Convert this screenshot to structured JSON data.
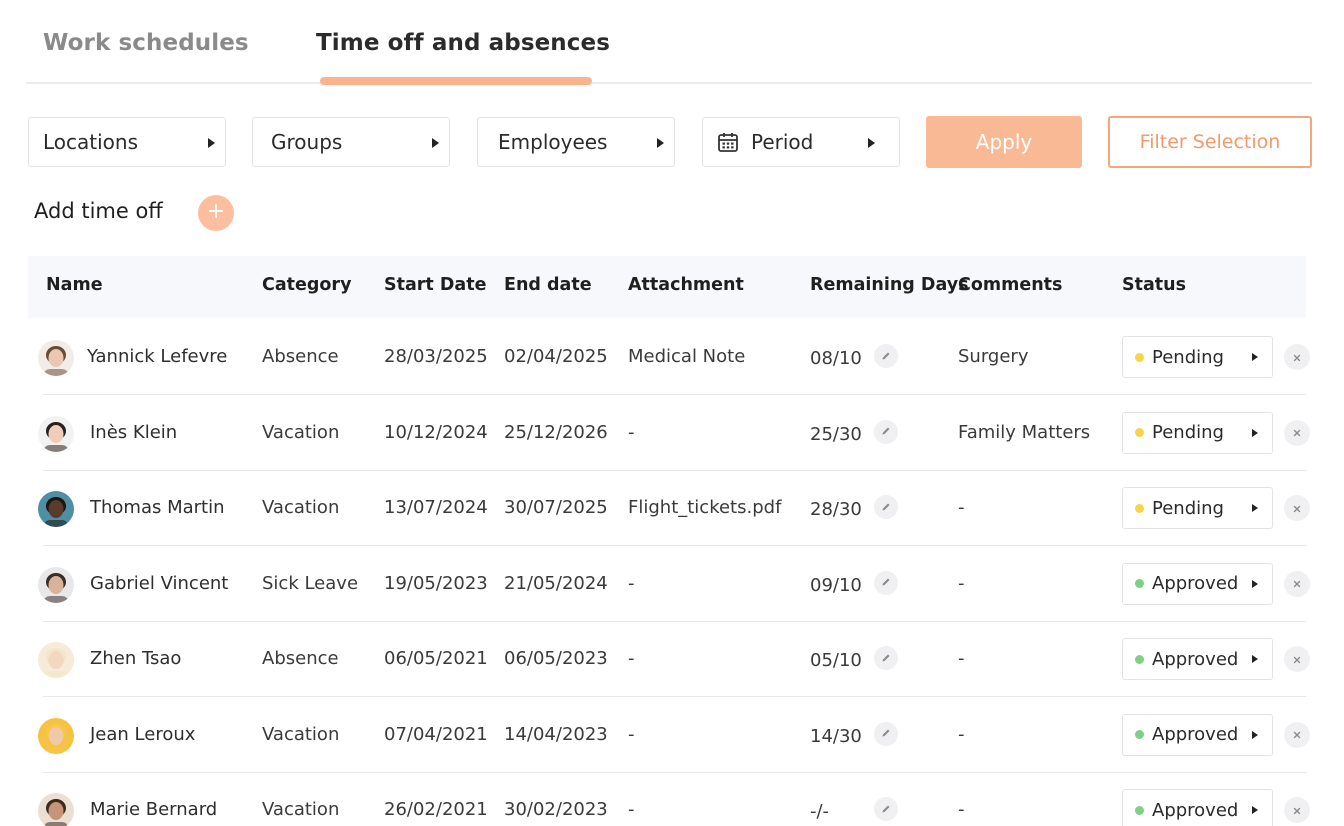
{
  "tabs": {
    "work_schedules": "Work schedules",
    "time_off": "Time off and absences"
  },
  "filters": {
    "locations": "Locations",
    "groups": "Groups",
    "employees": "Employees",
    "period": "Period",
    "apply": "Apply",
    "filter_selection": "Filter Selection"
  },
  "add_time_off": {
    "label": "Add time off",
    "icon": "plus-icon"
  },
  "table": {
    "headers": {
      "name": "Name",
      "category": "Category",
      "start_date": "Start Date",
      "end_date": "End date",
      "attachment": "Attachment",
      "remaining_days": "Remaining Days",
      "comments": "Comments",
      "status": "Status"
    },
    "rows": [
      {
        "name": "Yannick Lefevre",
        "category": "Absence",
        "start": "28/03/2025",
        "end": "02/04/2025",
        "attachment": "Medical Note",
        "remaining": "08/10",
        "comments": "Surgery",
        "status": "Pending"
      },
      {
        "name": "Inès Klein",
        "category": "Vacation",
        "start": "10/12/2024",
        "end": "25/12/2026",
        "attachment": "-",
        "remaining": "25/30",
        "comments": "Family Matters",
        "status": "Pending"
      },
      {
        "name": "Thomas  Martin",
        "category": "Vacation",
        "start": "13/07/2024",
        "end": "30/07/2025",
        "attachment": "Flight_tickets.pdf",
        "remaining": "28/30",
        "comments": "-",
        "status": "Pending"
      },
      {
        "name": "Gabriel  Vincent",
        "category": "Sick Leave",
        "start": "19/05/2023",
        "end": "21/05/2024",
        "attachment": "-",
        "remaining": "09/10",
        "comments": "-",
        "status": "Approved"
      },
      {
        "name": "Zhen Tsao",
        "category": "Absence",
        "start": "06/05/2021",
        "end": "06/05/2023",
        "attachment": "-",
        "remaining": "05/10",
        "comments": "-",
        "status": "Approved"
      },
      {
        "name": "Jean  Leroux",
        "category": "Vacation",
        "start": "07/04/2021",
        "end": "14/04/2023",
        "attachment": "-",
        "remaining": "14/30",
        "comments": "-",
        "status": "Approved"
      },
      {
        "name": "Marie Bernard",
        "category": "Vacation",
        "start": "26/02/2021",
        "end": "30/02/2023",
        "attachment": "-",
        "remaining": "-/-",
        "comments": "-",
        "status": "Approved"
      }
    ]
  },
  "colors": {
    "accent": "#f9b995",
    "accent_border": "#f7a57a",
    "pending": "#f7d54a",
    "approved": "#7fcf86"
  }
}
